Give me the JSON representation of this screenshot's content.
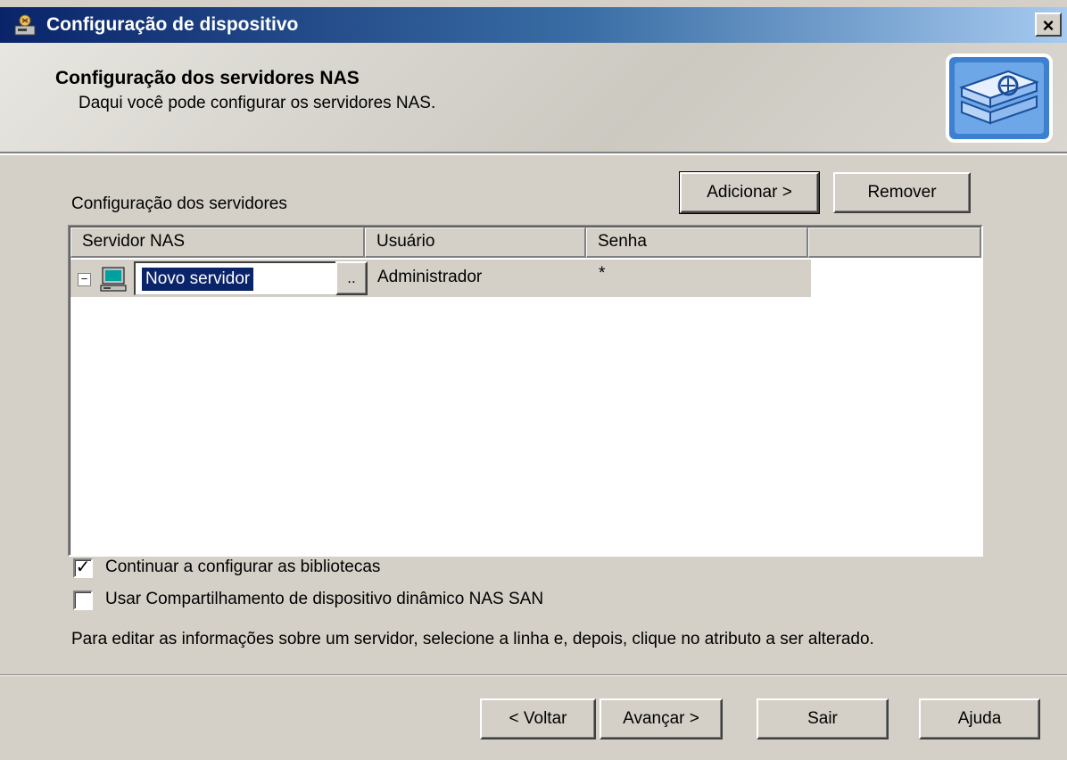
{
  "window": {
    "title": "Configuração de dispositivo",
    "close_label": "×"
  },
  "header": {
    "title": "Configuração dos servidores NAS",
    "subtitle": "Daqui você pode configurar os servidores NAS."
  },
  "servers": {
    "section_label": "Configuração dos servidores",
    "add_button": "Adicionar >",
    "remove_button": "Remover",
    "columns": [
      "Servidor NAS",
      "Usuário",
      "Senha",
      ""
    ],
    "rows": [
      {
        "toggle": "−",
        "server": "Novo servidor",
        "browse": "..",
        "user": "Administrador",
        "password": "*"
      }
    ]
  },
  "options": {
    "continue_libraries": {
      "label": "Continuar a configurar as bibliotecas",
      "checked": true,
      "mark": "✓"
    },
    "dynamic_sharing": {
      "label": "Usar Compartilhamento de dispositivo dinâmico NAS SAN",
      "checked": false,
      "mark": ""
    }
  },
  "info_text": "Para editar as informações sobre um servidor, selecione a linha e, depois, clique no atributo a ser alterado.",
  "footer": {
    "back": "< Voltar",
    "next": "Avançar >",
    "exit": "Sair",
    "help": "Ajuda"
  },
  "colors": {
    "titlebar_start": "#0a246a",
    "titlebar_end": "#a6caf0",
    "face": "#d4d0c8",
    "selection": "#0a246a"
  },
  "icons": {
    "title": "device-config-icon",
    "header": "nas-server-stack-icon",
    "row": "computer-icon",
    "close": "close-icon"
  }
}
